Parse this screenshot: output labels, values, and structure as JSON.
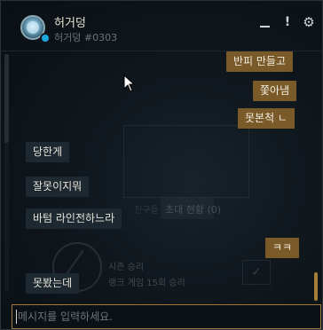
{
  "header": {
    "name": "허거덩",
    "tag": "허거덩 #0303",
    "minimize_icon": "minimize-icon",
    "alert_label": "!",
    "settings_label": "⚙"
  },
  "background": {
    "tab_invite": "초대 현황 (0)",
    "tab_hint": "친구들",
    "season_wins": "시즌 승리",
    "ranked_games": "랭크 게임 15회 승리"
  },
  "messages": [
    {
      "direction": "out",
      "text": "반피 만들고"
    },
    {
      "direction": "out",
      "text": "쫓아냄"
    },
    {
      "direction": "out",
      "text": "못본척 ㄴ"
    },
    {
      "direction": "in",
      "text": "당한게"
    },
    {
      "direction": "in",
      "text": "잘못이지뭐"
    },
    {
      "direction": "in",
      "text": "바텀 라인전하느라"
    },
    {
      "direction": "out",
      "text": "ㅋㅋ"
    },
    {
      "direction": "in",
      "text": "못봤는데"
    }
  ],
  "input": {
    "placeholder": "메시지를 입력하세요.",
    "value": ""
  },
  "colors": {
    "outgoing_bubble": "#7b5a2a",
    "incoming_bubble": "#1e2830",
    "accent": "#a07a3a",
    "status_online": "#1ba7e0"
  }
}
